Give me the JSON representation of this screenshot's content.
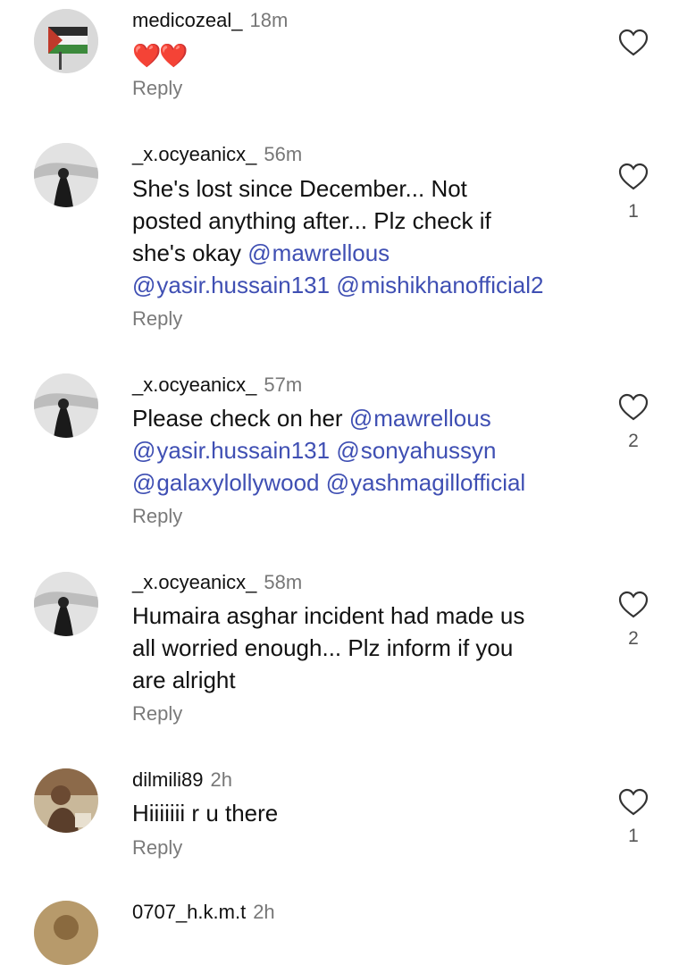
{
  "comments": [
    {
      "username": "medicozeal_",
      "time": "18m",
      "text": "❤️❤️",
      "reply": "Reply",
      "likes": ""
    },
    {
      "username": "_x.ocyeanicx_",
      "time": "56m",
      "line1": "She's lost since December... Not",
      "line2": "posted anything after... Plz check if",
      "line3_text": "she's okay ",
      "mentions": [
        "mawrellous",
        "yasir.hussain131",
        "mishikhanofficial2"
      ],
      "reply": "Reply",
      "likes": "1"
    },
    {
      "username": "_x.ocyeanicx_",
      "time": "57m",
      "line1_text": "Please check on her ",
      "mentions": [
        "mawrellous",
        "yasir.hussain131",
        "sonyahussyn",
        "galaxylollywood",
        "yashmagillofficial"
      ],
      "reply": "Reply",
      "likes": "2"
    },
    {
      "username": "_x.ocyeanicx_",
      "time": "58m",
      "line1": "Humaira asghar incident had made us",
      "line2": "all worried enough... Plz inform if you",
      "line3": "are alright",
      "reply": "Reply",
      "likes": "2"
    },
    {
      "username": "dilmili89",
      "time": "2h",
      "text": "Hiiiiiii r u there",
      "reply": "Reply",
      "likes": "1"
    },
    {
      "username": "0707_h.k.m.t",
      "time": "2h"
    }
  ],
  "icons": {
    "like": "heart-outline-icon",
    "mention": "threads-at-icon"
  },
  "colors": {
    "mention": "#3f4fb3",
    "muted": "#7a7a7a",
    "heart": "#e02424"
  }
}
